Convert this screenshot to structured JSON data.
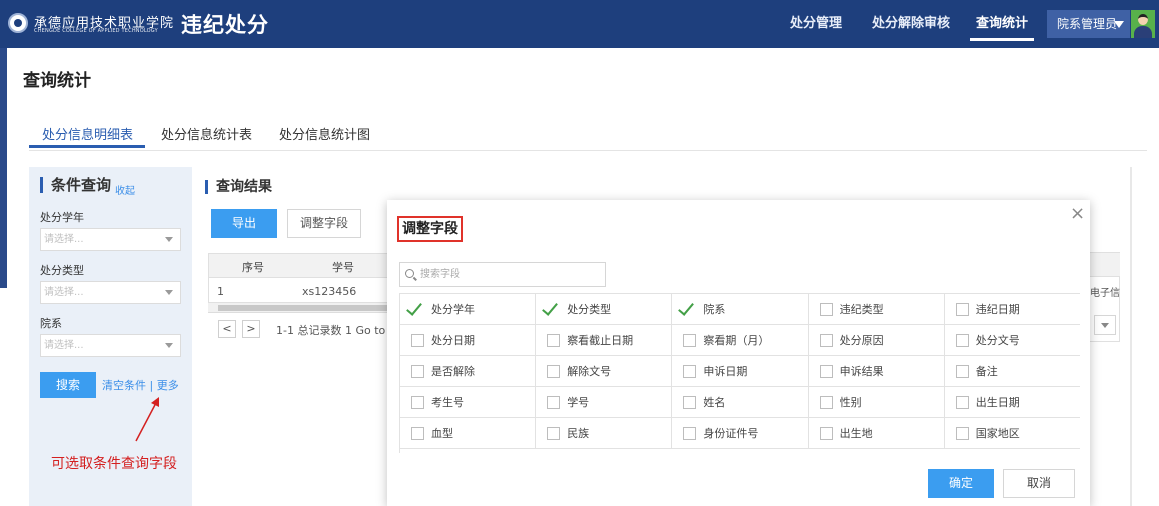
{
  "header": {
    "school_name": "承德应用技术职业学院",
    "school_name_en": "CHENGDE COLLEGE OF APPLIED TECHNOLOGY",
    "app_title": "违纪处分",
    "nav": [
      "处分管理",
      "处分解除审核",
      "查询统计"
    ],
    "active_nav": "查询统计",
    "user": "院系管理员"
  },
  "page": {
    "title": "查询统计",
    "tabs": [
      "处分信息明细表",
      "处分信息统计表",
      "处分信息统计图"
    ],
    "active_tab": "处分信息明细表"
  },
  "filter": {
    "heading": "条件查询",
    "collapse": "收起",
    "fields": [
      {
        "label": "处分学年",
        "placeholder": "请选择..."
      },
      {
        "label": "处分类型",
        "placeholder": "请选择..."
      },
      {
        "label": "院系",
        "placeholder": "请选择..."
      }
    ],
    "search": "搜索",
    "clear_more": "清空条件 | 更多"
  },
  "annotation": "可选取条件查询字段",
  "results": {
    "heading": "查询结果",
    "export": "导出",
    "adjust": "调整字段",
    "columns": [
      "序号",
      "学号"
    ],
    "rows": [
      [
        "1",
        "xs123456"
      ]
    ],
    "pager_prev": "<",
    "pager_next": ">",
    "pager_text": "1-1 总记录数 1   Go to",
    "peek_text": "电子信"
  },
  "modal": {
    "title": "调整字段",
    "close": "×",
    "search_placeholder": "搜索字段",
    "fields": [
      {
        "label": "处分学年",
        "checked": true
      },
      {
        "label": "处分类型",
        "checked": true
      },
      {
        "label": "院系",
        "checked": true
      },
      {
        "label": "违纪类型",
        "checked": false
      },
      {
        "label": "违纪日期",
        "checked": false
      },
      {
        "label": "处分日期",
        "checked": false
      },
      {
        "label": "察看截止日期",
        "checked": false
      },
      {
        "label": "察看期（月）",
        "checked": false
      },
      {
        "label": "处分原因",
        "checked": false
      },
      {
        "label": "处分文号",
        "checked": false
      },
      {
        "label": "是否解除",
        "checked": false
      },
      {
        "label": "解除文号",
        "checked": false
      },
      {
        "label": "申诉日期",
        "checked": false
      },
      {
        "label": "申诉结果",
        "checked": false
      },
      {
        "label": "备注",
        "checked": false
      },
      {
        "label": "考生号",
        "checked": false
      },
      {
        "label": "学号",
        "checked": false
      },
      {
        "label": "姓名",
        "checked": false
      },
      {
        "label": "性别",
        "checked": false
      },
      {
        "label": "出生日期",
        "checked": false
      },
      {
        "label": "血型",
        "checked": false
      },
      {
        "label": "民族",
        "checked": false
      },
      {
        "label": "身份证件号",
        "checked": false
      },
      {
        "label": "出生地",
        "checked": false
      },
      {
        "label": "国家地区",
        "checked": false
      }
    ],
    "ok": "确定",
    "cancel": "取消"
  },
  "colors": {
    "nav_bg": "#1e3f7d",
    "primary": "#3b9df0",
    "check": "#43a047",
    "annotation": "#d42020"
  }
}
